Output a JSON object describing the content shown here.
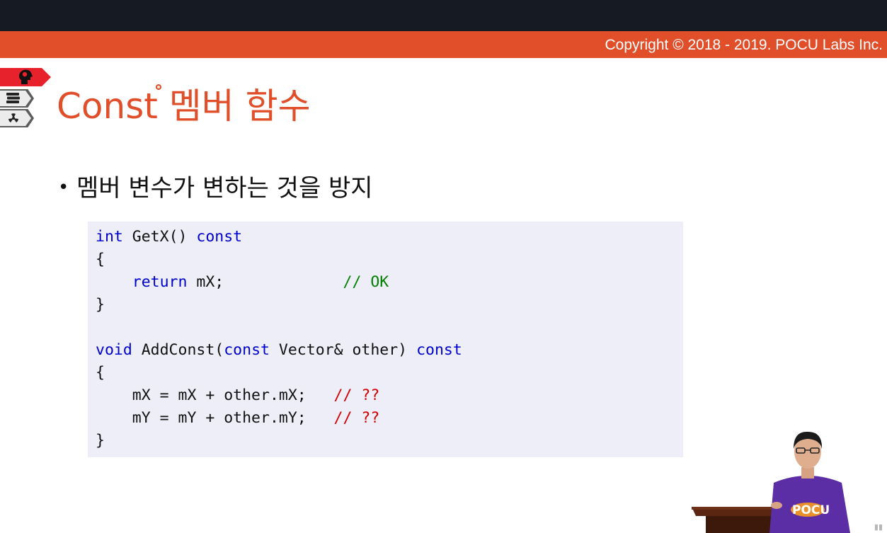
{
  "header": {
    "copyright": "Copyright © 2018 - 2019. POCU Labs Inc."
  },
  "side_tabs": [
    {
      "icon": "brain-head-icon",
      "active": true
    },
    {
      "icon": "book-stack-icon",
      "active": false
    },
    {
      "icon": "radiation-icon",
      "active": false
    }
  ],
  "slide": {
    "title": "Const 멤버 함수",
    "bullet": "멤버 변수가 변하는 것을 방지",
    "code_lines": [
      [
        {
          "t": "int",
          "c": "kw"
        },
        {
          "t": " GetX() ",
          "c": ""
        },
        {
          "t": "const",
          "c": "kw"
        }
      ],
      [
        {
          "t": "{",
          "c": ""
        }
      ],
      [
        {
          "t": "    ",
          "c": ""
        },
        {
          "t": "return",
          "c": "kw"
        },
        {
          "t": " mX;             ",
          "c": ""
        },
        {
          "t": "// OK",
          "c": "cm-ok"
        }
      ],
      [
        {
          "t": "}",
          "c": ""
        }
      ],
      [
        {
          "t": "",
          "c": ""
        }
      ],
      [
        {
          "t": "void",
          "c": "kw"
        },
        {
          "t": " AddConst(",
          "c": ""
        },
        {
          "t": "const",
          "c": "kw"
        },
        {
          "t": " Vector& other) ",
          "c": ""
        },
        {
          "t": "const",
          "c": "kw"
        }
      ],
      [
        {
          "t": "{",
          "c": ""
        }
      ],
      [
        {
          "t": "    mX = mX + other.mX;   ",
          "c": ""
        },
        {
          "t": "// ??",
          "c": "cm-q"
        }
      ],
      [
        {
          "t": "    mY = mY + other.mY;   ",
          "c": ""
        },
        {
          "t": "// ??",
          "c": "cm-q"
        }
      ],
      [
        {
          "t": "}",
          "c": ""
        }
      ]
    ]
  },
  "colors": {
    "accent": "#e04f2a",
    "top_bar": "#161a22",
    "code_bg": "#eeeef8",
    "keyword": "#0000d0",
    "comment_ok": "#008000",
    "comment_warn": "#d40000"
  },
  "presenter": {
    "shirt_text": "POCU"
  }
}
